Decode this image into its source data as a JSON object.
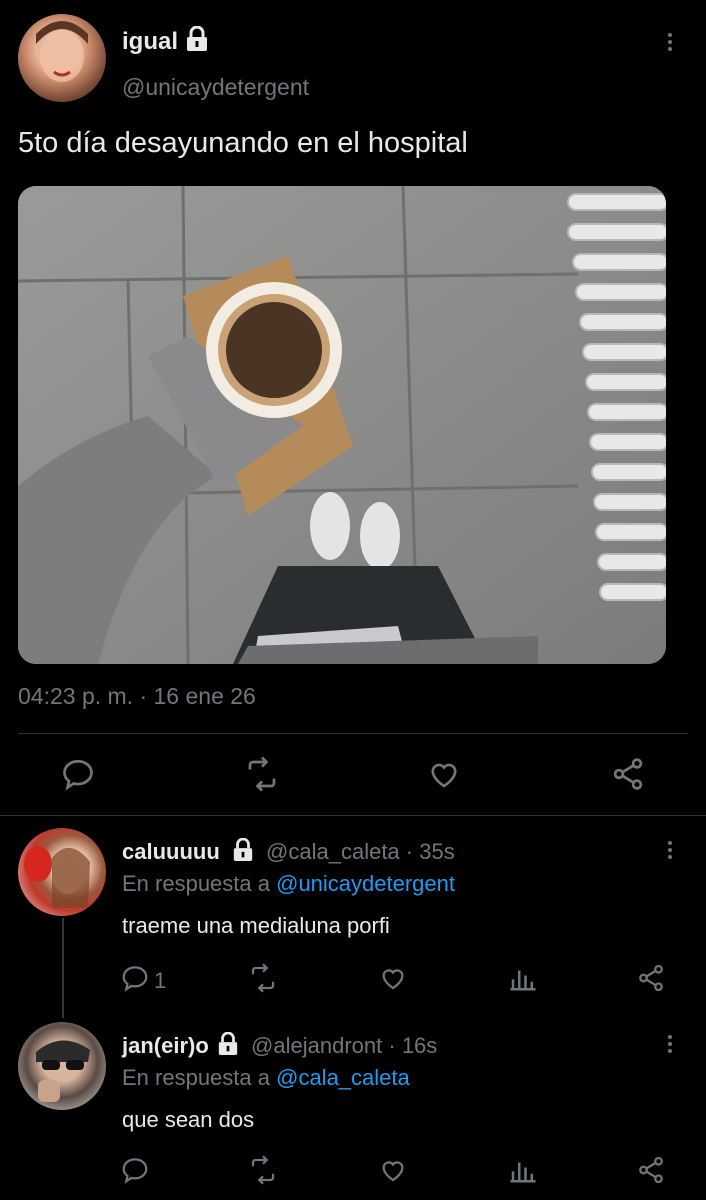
{
  "main_tweet": {
    "display_name": "igual",
    "handle": "@unicaydetergent",
    "text": "5to día desayunando en el hospital",
    "timestamp": "04:23 p. m. · 16 ene 26",
    "image_alt_semantic": "coffee-cup-photo"
  },
  "replies": [
    {
      "display_name": "caluuuuu",
      "handle": "@cala_caleta",
      "time": "· 35s",
      "in_reply_prefix": "En respuesta a",
      "in_reply_to": "@unicaydetergent",
      "text": "traeme una medialuna porfi",
      "reply_count": "1"
    },
    {
      "display_name": "jan(eir)o",
      "handle": "@alejandront",
      "time": "· 16s",
      "in_reply_prefix": "En respuesta a",
      "in_reply_to": "@cala_caleta",
      "text": "que sean dos",
      "reply_count": ""
    }
  ],
  "colors": {
    "background": "#000000",
    "text": "#e7e9ea",
    "secondary": "#71767b",
    "link": "#1d9bf0",
    "divider": "#2f3336"
  }
}
